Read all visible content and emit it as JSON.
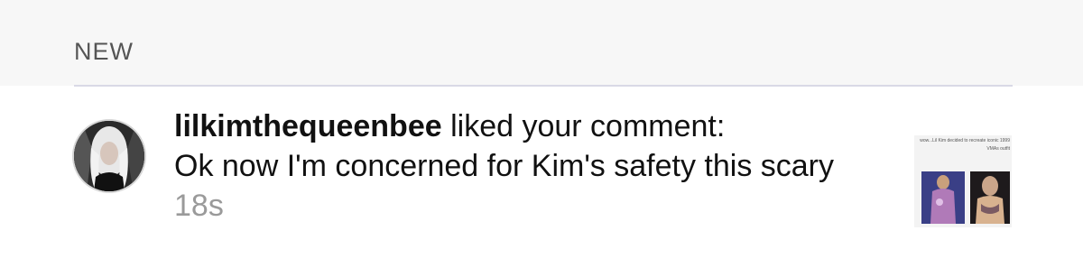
{
  "activity": {
    "section_label": "NEW",
    "notification": {
      "username": "lilkimthequeenbee",
      "action": " liked your comment:",
      "comment": "Ok now I'm concerned for Kim's safety this scary",
      "time": "18s",
      "post_thumbnail_caption": "wow...Lil Kim decided to recreate iconic 1999 VMAs outfit"
    }
  }
}
